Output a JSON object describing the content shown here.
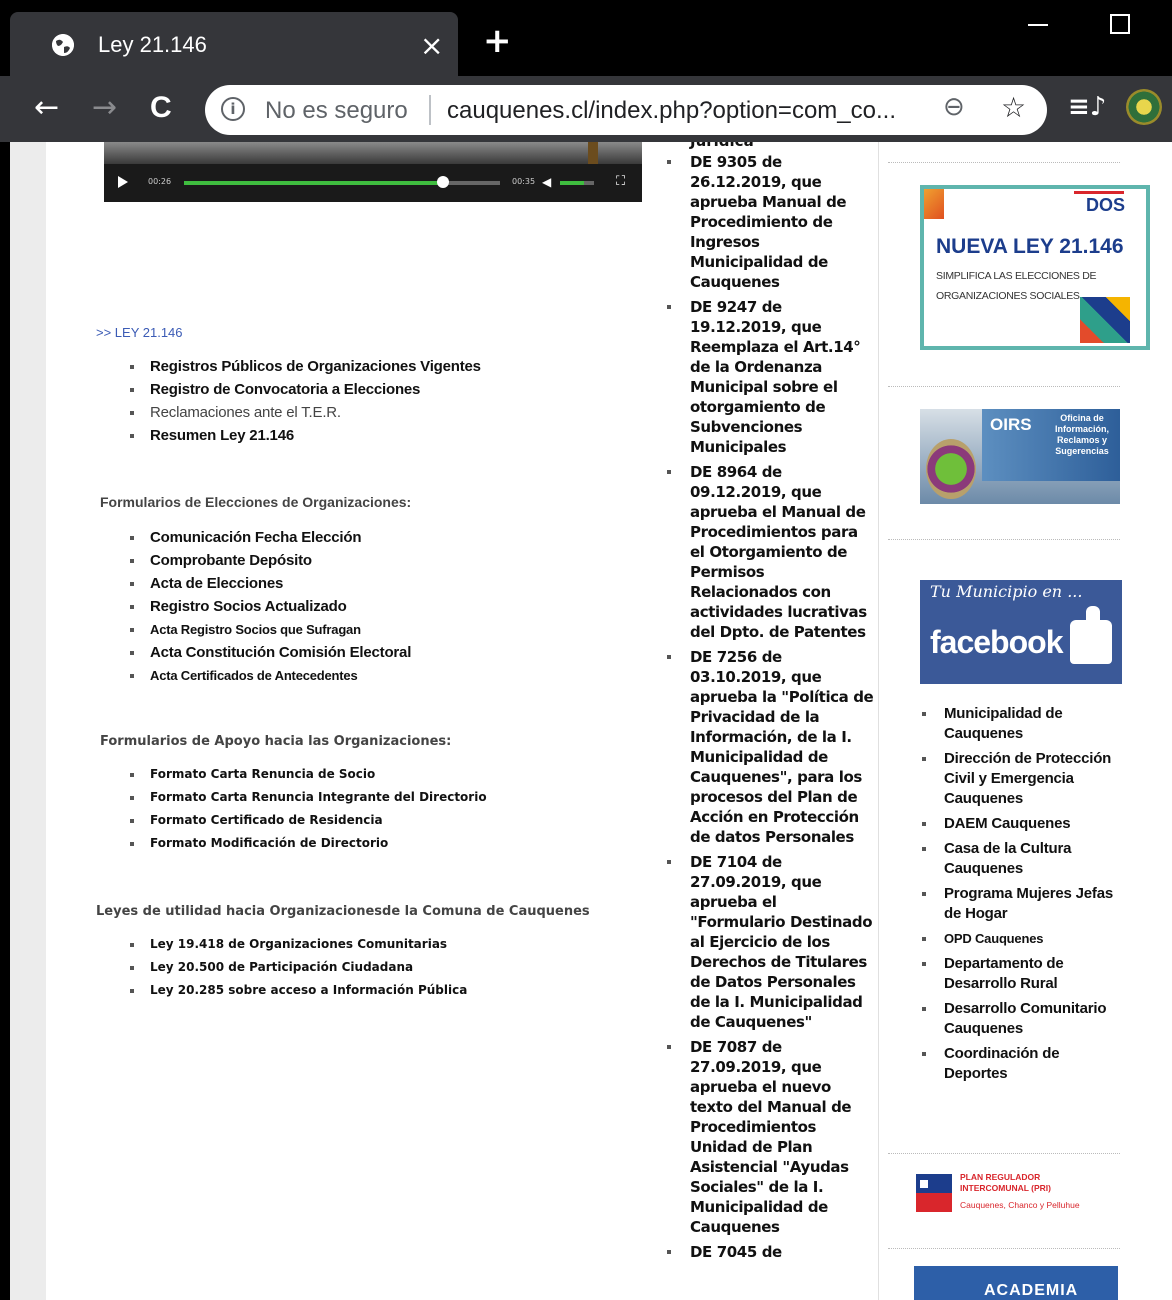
{
  "browser": {
    "tab_title": "Ley 21.146",
    "tab_close": "×",
    "new_tab": "+",
    "not_secure": "No es seguro",
    "url": "cauquenes.cl/index.php?option=com_co...",
    "info_icon": "i",
    "zoom_icon": "⊖",
    "star_icon": "☆",
    "back": "←",
    "forward": "→",
    "reload": "C",
    "queue_icon": "≡♪"
  },
  "video": {
    "time_current": "00:26",
    "time_total": "00:35",
    "progress_fraction": 0.82,
    "volume_fraction": 0.7
  },
  "main": {
    "ley_link": ">> LEY 21.146",
    "ley_items": [
      "Registros Públicos de Organizaciones Vigentes",
      "Registro de Convocatoria a Elecciones",
      "Reclamaciones ante el T.E.R.",
      "Resumen Ley 21.146"
    ],
    "form_elec_heading": "Formularios de Elecciones de Organizaciones:",
    "form_elec_items": [
      "Comunicación Fecha Elección",
      "Comprobante Depósito",
      "Acta de Elecciones",
      "Registro Socios Actualizado",
      "Acta Registro Socios que Sufragan",
      "Acta Constitución Comisión Electoral",
      "Acta Certificados de Antecedentes"
    ],
    "form_apoyo_heading": "Formularios de Apoyo hacia las Organizaciones:",
    "form_apoyo_items": [
      "Formato Carta Renuncia de Socio",
      "Formato Carta Renuncia Integrante del Directorio",
      "Formato Certificado de Residencia",
      "Formato Modificación de Directorio"
    ],
    "leyes_heading": "Leyes de utilidad hacia Organizacionesde la Comuna de Cauquenes",
    "leyes_items": [
      "Ley 19.418 de Organizaciones Comunitarias",
      "Ley 20.500 de Participación Ciudadana",
      "Ley 20.285 sobre acceso a Información Pública"
    ]
  },
  "middle": {
    "cut_text": "Jurídica",
    "decrees": [
      "DE 9305 de 26.12.2019, que aprueba Manual de Procedimiento de Ingresos Municipalidad de Cauquenes",
      "DE 9247 de 19.12.2019, que Reemplaza el Art.14° de la Ordenanza Municipal sobre el otorgamiento de Subvenciones Municipales",
      "DE 8964 de 09.12.2019, que aprueba el Manual de Procedimientos para el Otorgamiento de Permisos Relacionados con actividades lucrativas del Dpto. de Patentes",
      "DE 7256 de 03.10.2019, que aprueba la \"Política de Privacidad de la Información, de la I. Municipalidad de Cauquenes\", para los procesos del Plan de Acción en Protección de datos Personales",
      "DE 7104 de 27.09.2019, que aprueba el \"Formulario Destinado al Ejercicio de los Derechos de Titulares de Datos Personales de la I. Municipalidad de Cauquenes\"",
      "DE 7087 de 27.09.2019, que aprueba el nuevo texto del Manual de Procedimientos Unidad de Plan Asistencial \"Ayudas Sociales\" de la I. Municipalidad de Cauquenes",
      "DE 7045 de"
    ]
  },
  "right": {
    "ley_banner_dos": "DOS",
    "ley_banner_title": "NUEVA LEY 21.146",
    "ley_banner_sub1": "SIMPLIFICA LAS ELECCIONES DE",
    "ley_banner_sub2": "ORGANIZACIONES SOCIALES",
    "oirs_title": "OIRS",
    "oirs_desc": "Oficina de Información, Reclamos y Sugerencias",
    "fb_tagline": "Tu Municipio en ...",
    "fb_word": "facebook",
    "links": [
      "Municipalidad de Cauquenes",
      "Dirección de Protección Civil y Emergencia Cauquenes",
      "DAEM Cauquenes",
      "Casa de la Cultura Cauquenes",
      "Programa Mujeres Jefas de Hogar",
      "OPD Cauquenes",
      "Departamento de Desarrollo Rural",
      "Desarrollo Comunitario Cauquenes",
      "Coordinación de Deportes"
    ],
    "plan_line1": "PLAN REGULADOR",
    "plan_line2": "INTERCOMUNAL (PRI)",
    "plan_line3": "Cauquenes, Chanco y Pelluhue",
    "acad_text": "ACADEMIA"
  }
}
